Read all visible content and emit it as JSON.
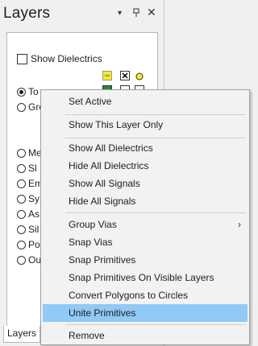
{
  "panel": {
    "title": "Layers",
    "header_icons": {
      "dropdown": "▾",
      "pin": "ᵖ",
      "close": "✕"
    },
    "show_dielectrics_label": "Show Dielectrics",
    "show_dielectrics_checked": false,
    "footer_tab": "Layers",
    "layers": [
      {
        "label": "To",
        "checked": true
      },
      {
        "label": "Gro",
        "checked": false
      },
      {
        "label": "Me",
        "checked": false
      },
      {
        "label": "Sl",
        "checked": false
      },
      {
        "label": "Em",
        "checked": false
      },
      {
        "label": "Sy",
        "checked": false
      },
      {
        "label": "As",
        "checked": false
      },
      {
        "label": "Sil",
        "checked": false
      },
      {
        "label": "Po",
        "checked": false
      },
      {
        "label": "Ou",
        "checked": false
      }
    ],
    "colors": {
      "yellow_swatch": "#f5ee1e",
      "green_swatch": "#1f8f2a"
    }
  },
  "context_menu": {
    "items": [
      {
        "label": "Set Active"
      },
      {
        "label": "Show This Layer Only"
      },
      {
        "label": "Show All Dielectrics"
      },
      {
        "label": "Hide All Dielectrics"
      },
      {
        "label": "Show All Signals"
      },
      {
        "label": "Hide All Signals"
      },
      {
        "label": "Group Vias",
        "submenu": true,
        "submenu_arrow": "›"
      },
      {
        "label": "Snap Vias"
      },
      {
        "label": "Snap Primitives"
      },
      {
        "label": "Snap Primitives On Visible Layers"
      },
      {
        "label": "Convert Polygons to Circles"
      },
      {
        "label": "Unite Primitives",
        "highlighted": true
      },
      {
        "label": "Remove"
      }
    ],
    "highlight_color": "#91c9f7"
  }
}
